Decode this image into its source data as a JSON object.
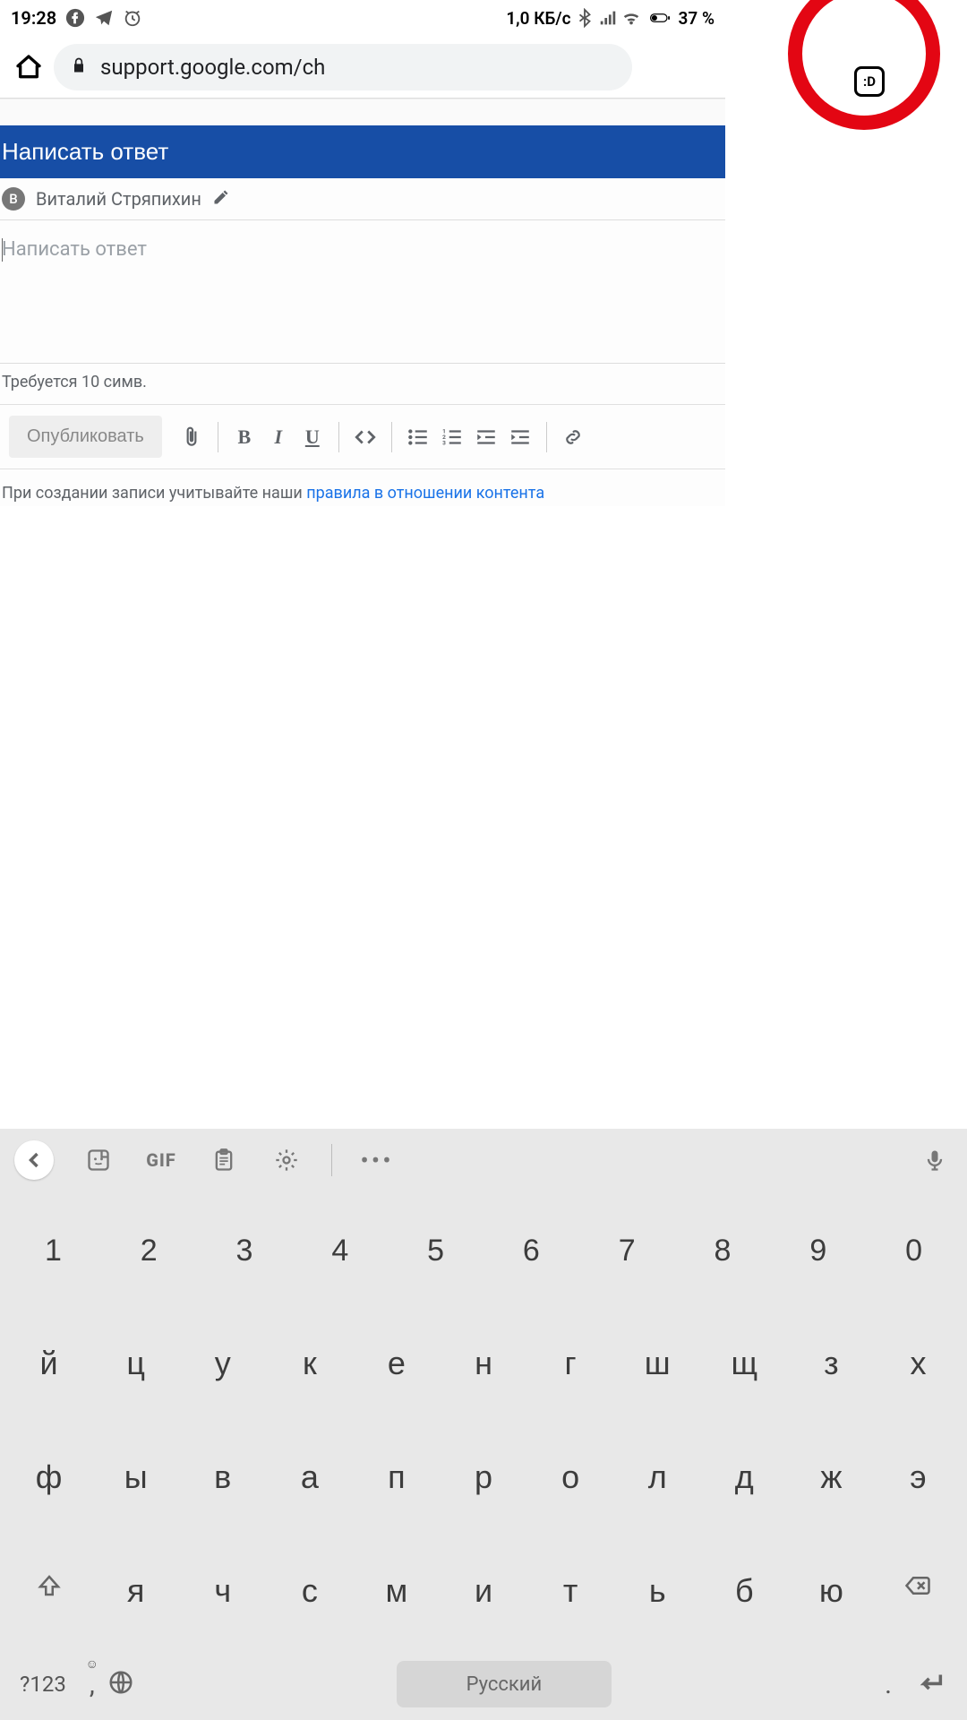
{
  "status": {
    "time": "19:28",
    "data_rate": "1,0 КБ/с",
    "battery": "37 %"
  },
  "browser": {
    "url": "support.google.com/ch",
    "tabs": ":D"
  },
  "page": {
    "header": "Написать ответ",
    "user_initial": "В",
    "user_name": "Виталий Стряпихин",
    "placeholder": "Написать ответ",
    "hint": "Требуется 10 симв.",
    "publish": "Опубликовать",
    "notice_prefix": "При создании записи учитывайте наши ",
    "notice_link": "правила в отношении контента"
  },
  "keyboard": {
    "gif": "GIF",
    "sym": "?123",
    "space": "Русский",
    "row_num": [
      "1",
      "2",
      "3",
      "4",
      "5",
      "6",
      "7",
      "8",
      "9",
      "0"
    ],
    "row1": [
      "й",
      "ц",
      "у",
      "к",
      "е",
      "н",
      "г",
      "ш",
      "щ",
      "з",
      "х"
    ],
    "row2": [
      "ф",
      "ы",
      "в",
      "а",
      "п",
      "р",
      "о",
      "л",
      "д",
      "ж",
      "э"
    ],
    "row3": [
      "я",
      "ч",
      "с",
      "м",
      "и",
      "т",
      "ь",
      "б",
      "ю"
    ],
    "comma": ",",
    "period": "."
  }
}
